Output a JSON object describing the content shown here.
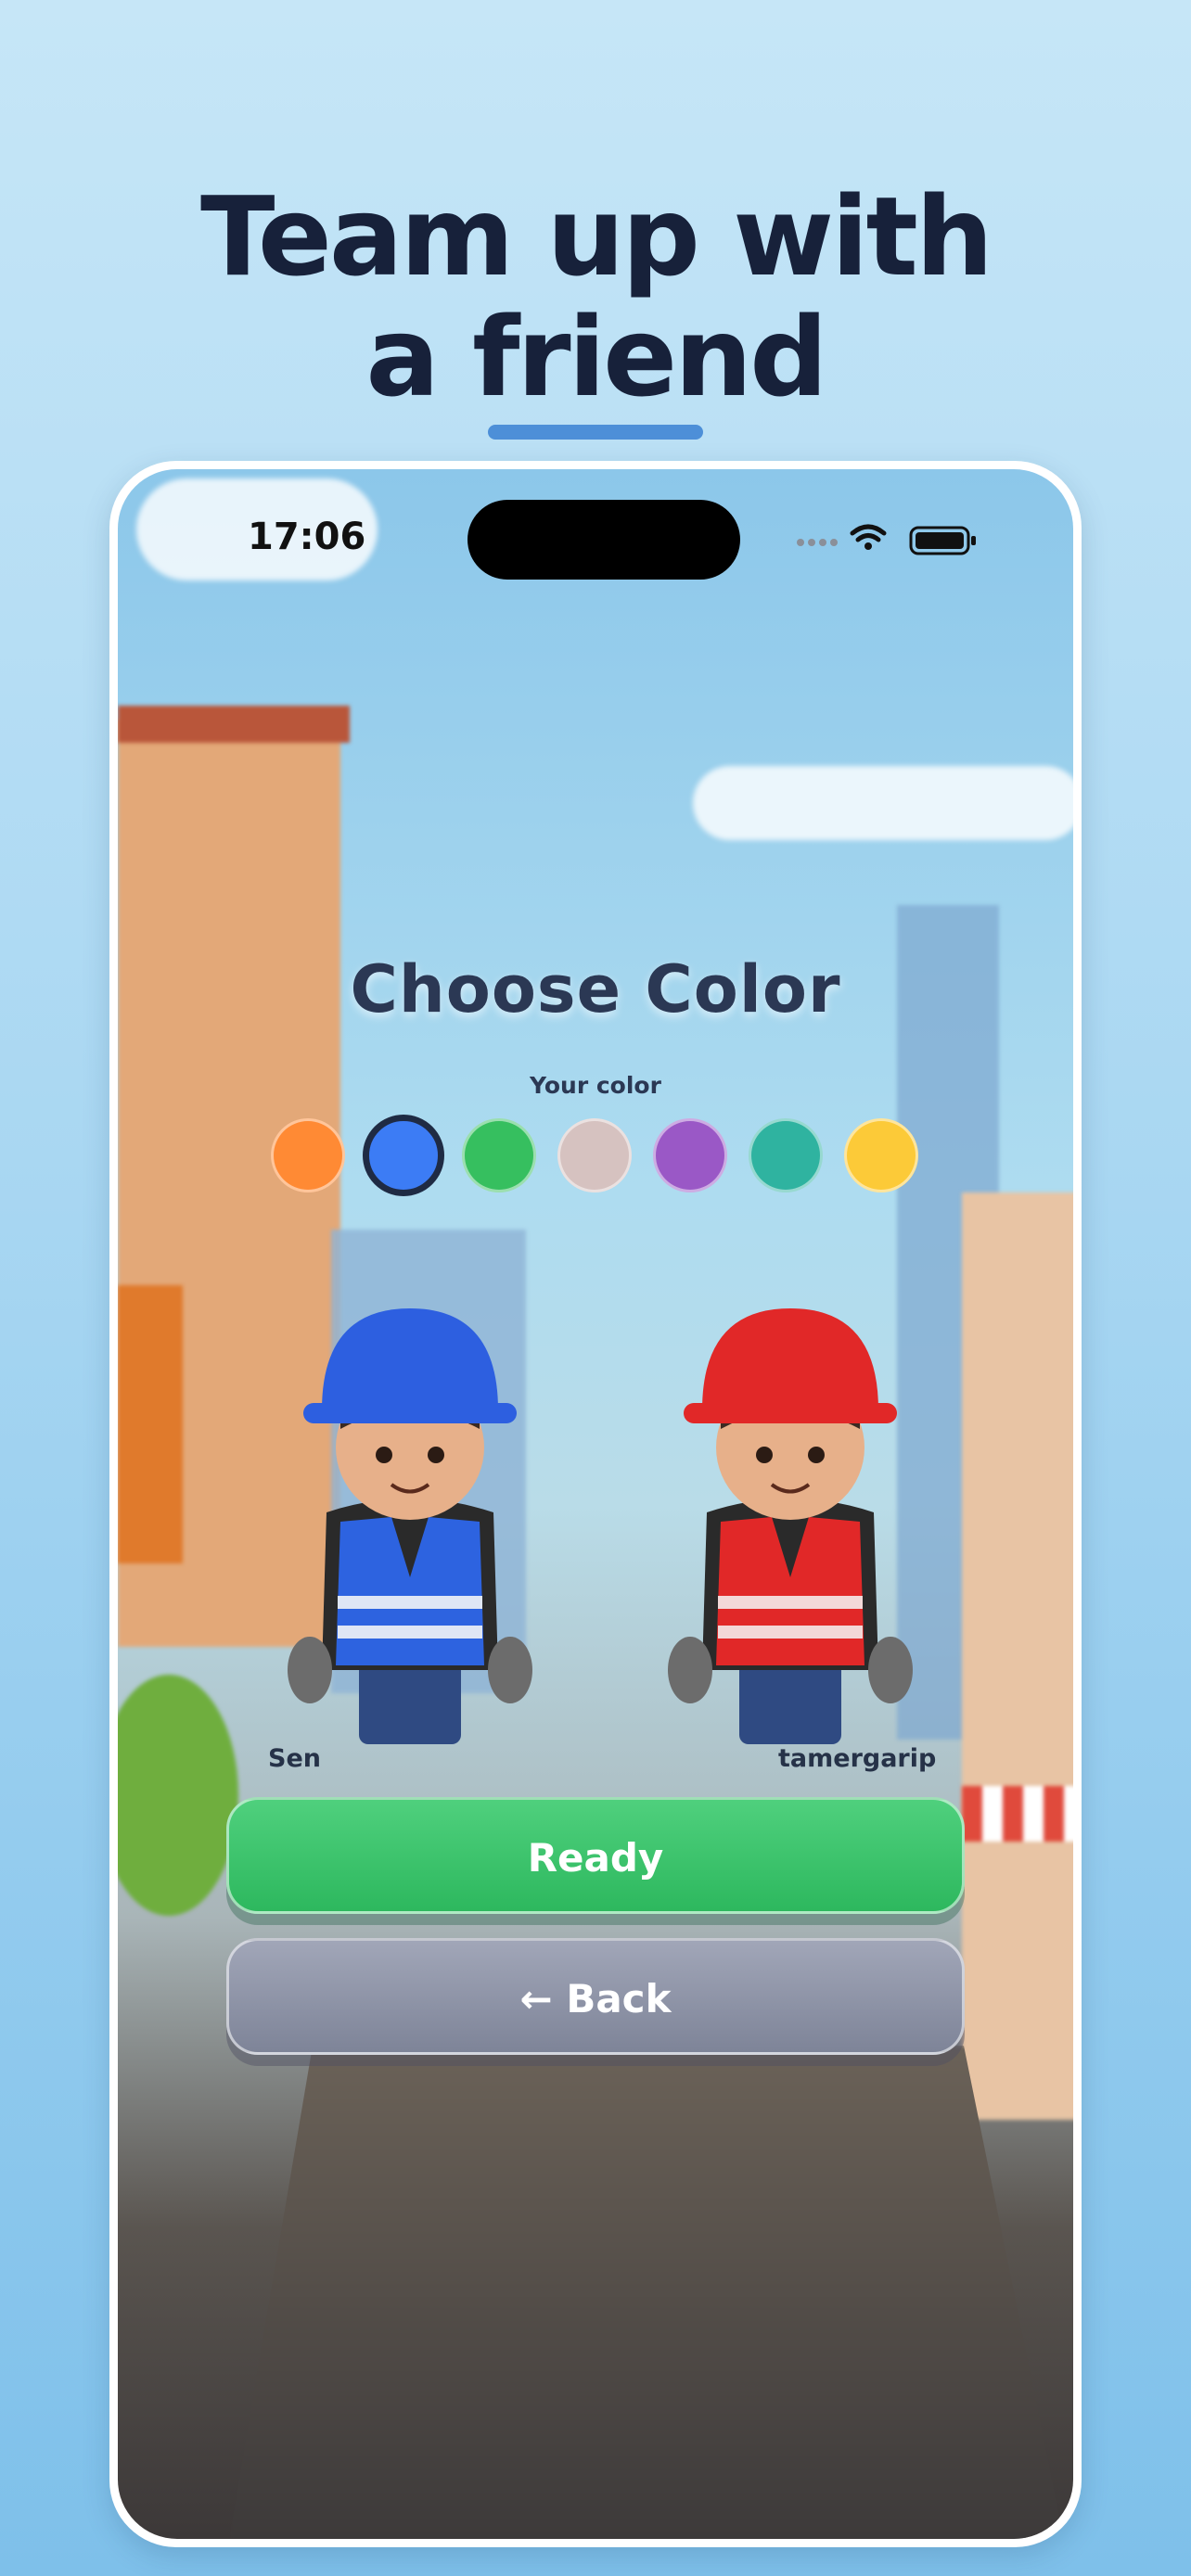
{
  "headline": {
    "line1": "Team up with",
    "line2": "a friend"
  },
  "status_bar": {
    "time": "17:06",
    "icons": [
      "signal-dots-icon",
      "wifi-icon",
      "battery-icon"
    ]
  },
  "lobby": {
    "title": "Choose Color",
    "your_color_label": "Your color",
    "colors": [
      {
        "name": "orange",
        "hex": "#ff8a34",
        "selected": false
      },
      {
        "name": "blue",
        "hex": "#3c7cf5",
        "selected": true
      },
      {
        "name": "green",
        "hex": "#36bf5f",
        "selected": false
      },
      {
        "name": "pink-gray",
        "hex": "#d6c2c0",
        "selected": false
      },
      {
        "name": "purple",
        "hex": "#9a58c6",
        "selected": false
      },
      {
        "name": "teal",
        "hex": "#2fb3a0",
        "selected": false
      },
      {
        "name": "yellow",
        "hex": "#fcca38",
        "selected": false
      }
    ],
    "players": [
      {
        "name": "Sen",
        "helmet_color": "#2d5fe0"
      },
      {
        "name": "tamergarip",
        "helmet_color": "#e12828"
      }
    ],
    "ready_label": "Ready",
    "back_label": "← Back"
  }
}
